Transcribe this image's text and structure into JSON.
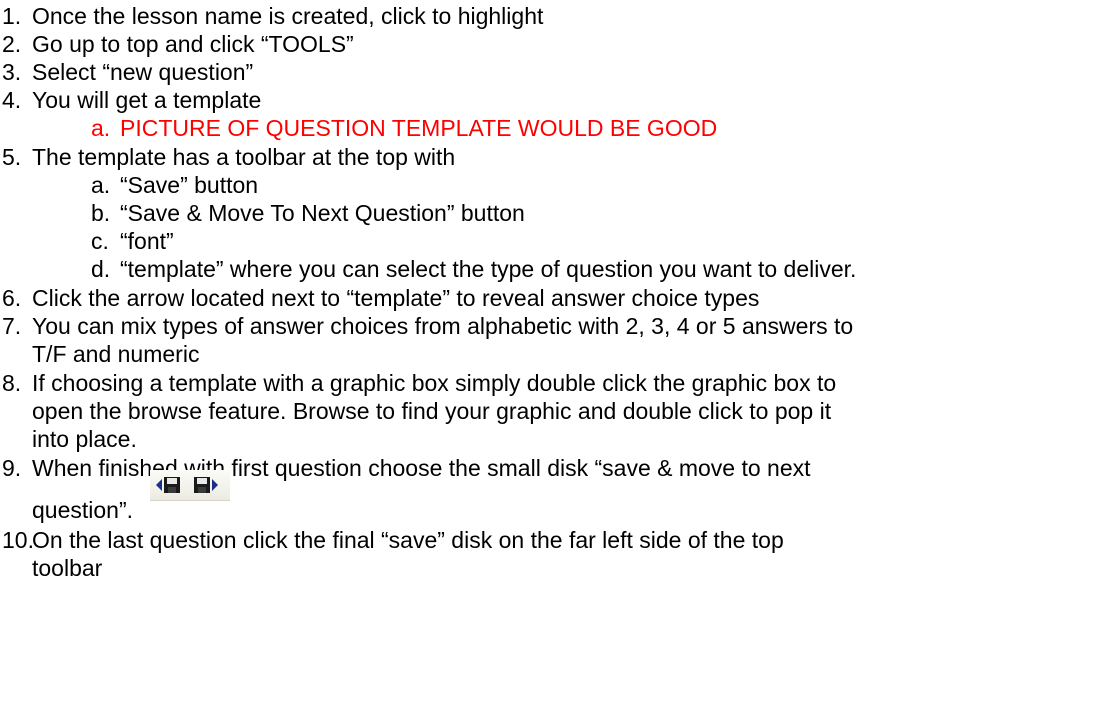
{
  "steps": [
    {
      "n": "1.",
      "text": "Once the lesson name is created, click to highlight"
    },
    {
      "n": "2.",
      "text": "Go up to top and click “TOOLS”"
    },
    {
      "n": "3.",
      "text": "Select “new question”"
    },
    {
      "n": "4.",
      "text": "You will get a template"
    },
    {
      "n": "a.",
      "text": "PICTURE OF QUESTION TEMPLATE WOULD BE GOOD",
      "color": "#ff0000"
    },
    {
      "n": "5.",
      "text": "The template has a toolbar at the top with"
    },
    {
      "n": "a.",
      "text": "“Save” button"
    },
    {
      "n": "b.",
      "text": "“Save & Move To Next Question” button"
    },
    {
      "n": "c.",
      "text": "“font”"
    },
    {
      "n": "d.",
      "text": "“template” where you can select the type of question you want to deliver."
    },
    {
      "n": "6.",
      "text": "Click the arrow located next to “template” to reveal answer choice types"
    },
    {
      "n": "7.",
      "text": "You can mix types of answer choices from alphabetic with 2, 3, 4 or 5 answers to",
      "cont": "T/F and numeric"
    },
    {
      "n": "8.",
      "text": "If choosing a template with a graphic box simply double click the graphic box to",
      "cont": "open the browse feature. Browse to find your graphic and double click to pop it",
      "cont2": "into place."
    },
    {
      "n": "9.",
      "text": "When finished with first question choose the small disk “save & move to next",
      "cont": "question”."
    },
    {
      "n": "10.",
      "text": "On the last question click the final “save” disk on the far left side of the top",
      "cont": "toolbar"
    }
  ],
  "icons": [
    "save-back-disk-icon",
    "save-next-disk-icon"
  ]
}
